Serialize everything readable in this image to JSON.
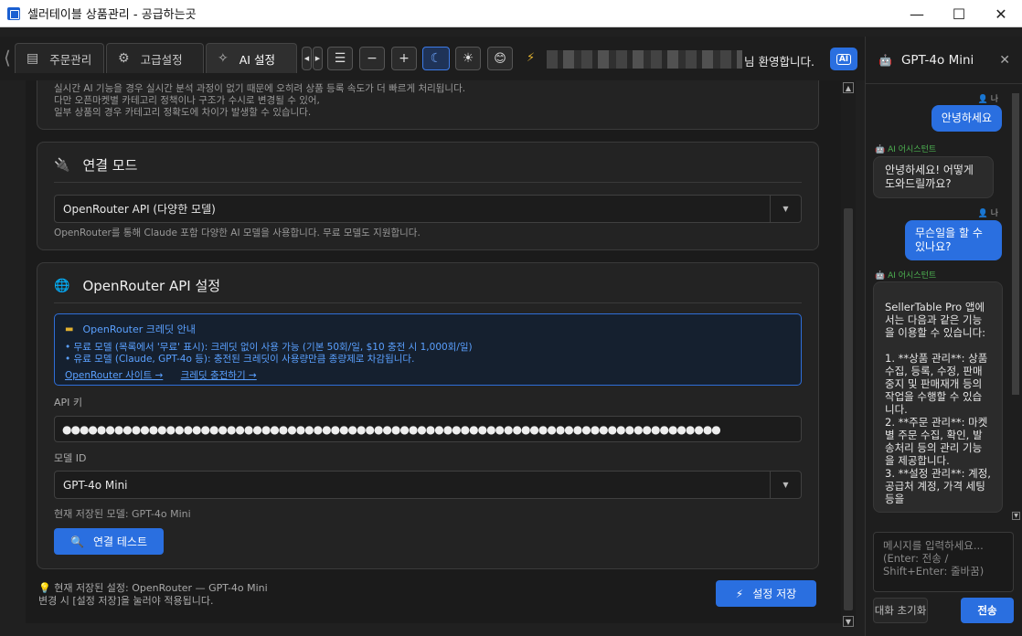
{
  "window": {
    "title": "셀러테이블 상품관리 - 공급하는곳",
    "controls": [
      "—",
      "☐",
      "✕"
    ]
  },
  "toolbar": {
    "tabs": [
      {
        "label": "주문관리",
        "icon": "clipboard-icon"
      },
      {
        "label": "고급설정",
        "icon": "gear-icon"
      },
      {
        "label": "AI 설정",
        "icon": "sparkle-icon"
      }
    ],
    "nav_left": "◀",
    "nav_right": "▶",
    "menu_icon": "☰",
    "zoom_out": "−",
    "zoom_in": "+",
    "theme_dark_icon": "☾",
    "theme_light_icon": "☀",
    "emoji_icon": "😊",
    "bolt_icon": "⚡",
    "welcome_text": "님 환영합니다.",
    "ai_chat_button": "AI"
  },
  "cards": {
    "intro": {
      "lines": [
        "실시간 AI 기능을 경우 실시간 분석 과정이 없기 때문에 오히려 상품 등록 속도가 더 빠르게 처리됩니다.",
        "다만 오픈마켓별 카테고리 정책이나 구조가 수시로 변경될 수 있어,",
        "일부 상품의 경우 카테고리 정확도에 차이가 발생할 수 있습니다."
      ]
    },
    "connection": {
      "icon": "plug-icon",
      "title": "연결 모드",
      "selected": "OpenRouter API (다양한 모델)",
      "caret": "▼",
      "help": "OpenRouter를 통해 Claude 포함 다양한 AI 모델을 사용합니다. 무료 모델도 지원합니다."
    },
    "openrouter": {
      "icon": "globe-icon",
      "title": "OpenRouter API 설정",
      "credit_box": {
        "icon": "card-icon",
        "heading": "OpenRouter 크레딧 안내",
        "line1": "• 무료 모델 (목록에서 '무료' 표시): 크레딧 없이 사용 가능 (기본 50회/일, $10 충전 시 1,000회/일)",
        "line2": "• 유료 모델 (Claude, GPT-4o 등): 충전된 크레딧이 사용량만큼 종량제로 차감됩니다.",
        "link1": "OpenRouter 사이트 →",
        "link2": "크레딧 충전하기 →"
      },
      "api_key_label": "API 키",
      "api_key_value": "●●●●●●●●●●●●●●●●●●●●●●●●●●●●●●●●●●●●●●●●●●●●●●●●●●●●●●●●●●●●●●●●●●●●●●●●●●●●",
      "model_id_label": "모델 ID",
      "model_id_value": "GPT-4o Mini",
      "caret": "▼",
      "current_model": "현재 저장된 모델: GPT-4o Mini",
      "test_button": "연결 테스트",
      "test_icon": "magnifier-icon"
    }
  },
  "footer": {
    "bulb_icon": "💡",
    "saved_setting": "현재 저장된 설정: OpenRouter — GPT-4o Mini",
    "notice": "변경 시 [설정 저장]을 눌러야 적용됩니다.",
    "save_button": "설정 저장",
    "save_icon": "⚡"
  },
  "chat": {
    "bot_icon": "robot-icon",
    "model_name": "GPT-4o Mini",
    "close": "✕",
    "me_label": "👤 나",
    "ai_label": "🤖 AI 어시스턴트",
    "messages": [
      {
        "role": "user",
        "text": "안녕하세요"
      },
      {
        "role": "ai",
        "text": "안녕하세요! 어떻게 도와드릴까요?"
      },
      {
        "role": "user",
        "text": "무슨일을 할 수 있나요?"
      },
      {
        "role": "ai",
        "text": "SellerTable Pro 앱에서는 다음과 같은 기능을 이용할 수 있습니다:\n\n1. **상품 관리**: 상품 수집, 등록, 수정, 판매중지 및 판매재개 등의 작업을 수행할 수 있습니다.\n2. **주문 관리**: 마켓별 주문 수집, 확인, 발송처리 등의 관리 기능을 제공합니다.\n3. **설정 관리**: 계정, 공급처 계정, 가격 세팅 등을"
      }
    ],
    "input_placeholder": "메시지를 입력하세요... (Enter: 전송 / Shift+Enter: 줄바꿈)",
    "reset_button": "대화 초기화",
    "send_button": "전송"
  },
  "colors": {
    "accent": "#2a6fe0",
    "link": "#5aa0ff",
    "bg": "#1b1b1b",
    "card": "#232323"
  }
}
